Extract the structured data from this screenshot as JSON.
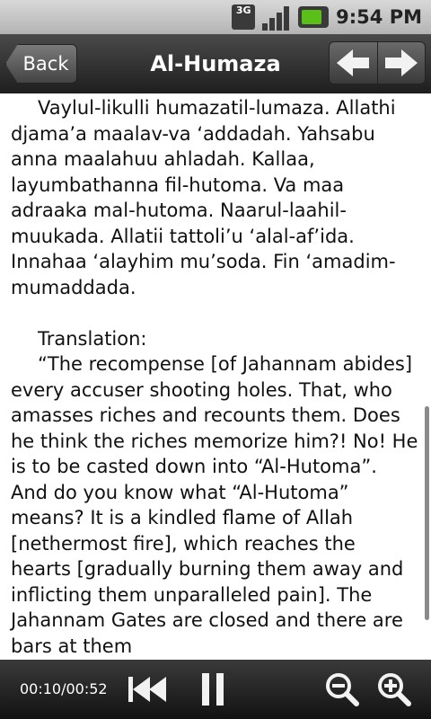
{
  "status_bar": {
    "network_label": "3G",
    "time": "9:54 PM",
    "icons": [
      "3g-data-icon",
      "signal-strength-icon",
      "battery-icon"
    ]
  },
  "header": {
    "back_label": "Back",
    "title": "Al-Humaza",
    "icons": [
      "arrow-left-icon",
      "arrow-right-icon"
    ]
  },
  "content": {
    "transliteration": "Vaylul-likulli humazatil-lumaza. Allathi djama’a maalav-va ‘addadah. Yahsabu anna maalahuu ahladah. Kallaa, layumbathanna fil-hutoma. Va maa adraaka mal-hutoma. Naarul-laahil-muukada. Allatii tattoli’u ‘alal-af’ida. Innahaa ‘alayhim mu’soda. Fin ‘amadim-mumaddada.",
    "translation_heading": "Translation:",
    "translation": "“The recompense [of Jahannam abides] every accuser shooting holes. That, who amasses riches and recounts them. Does he think the riches memorize him?! No! He is to be casted down into “Al-Hutoma”. And do you know what “Al-Hutoma” means? It is a kindled flame of Allah [nethermost fire], which reaches the hearts [gradually burning them away and inflicting them unparalleled pain]. The Jahannam Gates are closed and there are bars at them"
  },
  "player": {
    "time": "00:10/00:52",
    "icons": [
      "rewind-icon",
      "pause-icon",
      "zoom-out-icon",
      "zoom-in-icon"
    ]
  },
  "colors": {
    "status_bar": "#c4c4c4",
    "title_bar": "#2a2a2a",
    "text": "#111111",
    "battery_accent": "#5ac018"
  }
}
